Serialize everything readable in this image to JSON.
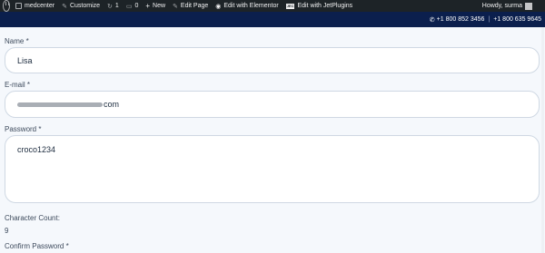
{
  "admin_bar": {
    "site_name": "medcenter",
    "customize": "Customize",
    "updates_count": "1",
    "comments_count": "0",
    "new_label": "New",
    "edit_page": "Edit Page",
    "edit_elementor": "Edit with Elementor",
    "edit_jet": "Edit with JetPlugins",
    "jet_icon_text": "JEC",
    "howdy": "Howdy, surma"
  },
  "header": {
    "phone1": "+1 800 852 3456",
    "separator": "|",
    "phone2": "+1 800 635 9645"
  },
  "form": {
    "name_label": "Name *",
    "name_value": "Lisa",
    "email_label": "E-mail *",
    "email_value_suffix": "com",
    "password_label": "Password *",
    "password_value": "croco1234",
    "char_count_label": "Character Count:",
    "char_count_value": "9",
    "confirm_label": "Confirm Password *"
  },
  "colors": {
    "admin_bar": "#1d2327",
    "header_bar": "#0b1f4d",
    "page_bg": "#f5f8fc",
    "field_border": "#cfd8e3"
  }
}
